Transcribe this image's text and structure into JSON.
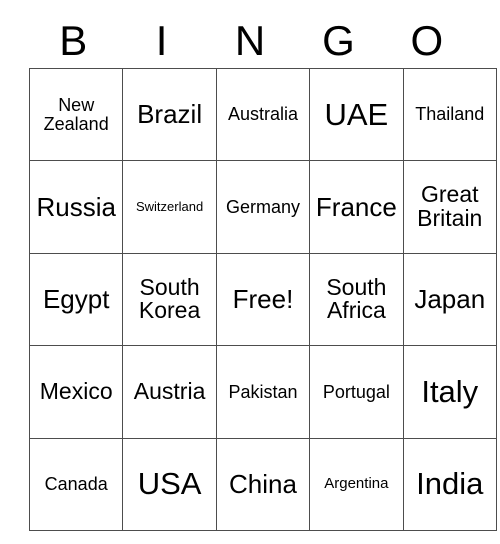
{
  "card": {
    "header_letters": [
      "B",
      "I",
      "N",
      "G",
      "O"
    ],
    "free_space_label": "Free!",
    "colors": {
      "background": "#ffffff",
      "text": "#000000",
      "border": "#4d4d4d"
    },
    "rows": [
      [
        {
          "label": "New Zealand",
          "size": "sm"
        },
        {
          "label": "Brazil",
          "size": "lg"
        },
        {
          "label": "Australia",
          "size": "sm"
        },
        {
          "label": "UAE",
          "size": "xl"
        },
        {
          "label": "Thailand",
          "size": "sm"
        }
      ],
      [
        {
          "label": "Russia",
          "size": "lg"
        },
        {
          "label": "Switzerland",
          "size": "xxs"
        },
        {
          "label": "Germany",
          "size": "sm"
        },
        {
          "label": "France",
          "size": "lg"
        },
        {
          "label": "Great Britain",
          "size": "md"
        }
      ],
      [
        {
          "label": "Egypt",
          "size": "lg"
        },
        {
          "label": "South Korea",
          "size": "md"
        },
        {
          "label": "Free!",
          "size": "lg"
        },
        {
          "label": "South Africa",
          "size": "md"
        },
        {
          "label": "Japan",
          "size": "lg"
        }
      ],
      [
        {
          "label": "Mexico",
          "size": "md"
        },
        {
          "label": "Austria",
          "size": "md"
        },
        {
          "label": "Pakistan",
          "size": "sm"
        },
        {
          "label": "Portugal",
          "size": "sm"
        },
        {
          "label": "Italy",
          "size": "xl"
        }
      ],
      [
        {
          "label": "Canada",
          "size": "sm"
        },
        {
          "label": "USA",
          "size": "xl"
        },
        {
          "label": "China",
          "size": "lg"
        },
        {
          "label": "Argentina",
          "size": "xs"
        },
        {
          "label": "India",
          "size": "xl"
        }
      ]
    ]
  }
}
